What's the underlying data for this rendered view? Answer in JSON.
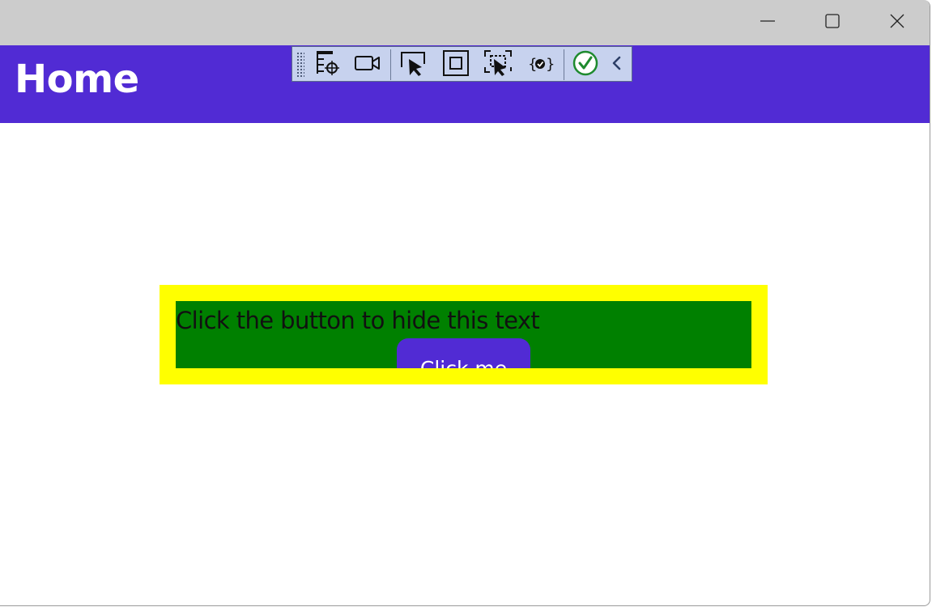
{
  "window": {
    "controls": {
      "minimize_icon": "minimize-icon",
      "maximize_icon": "maximize-icon",
      "close_icon": "close-icon"
    }
  },
  "header": {
    "title": "Home",
    "background_color": "#512bd4"
  },
  "debug_toolbar": {
    "tools": [
      {
        "icon": "go-to-live-visual-tree-icon"
      },
      {
        "icon": "record-icon"
      },
      {
        "icon": "select-element-icon"
      },
      {
        "icon": "display-layout-adorners-icon"
      },
      {
        "icon": "track-focus-icon"
      },
      {
        "icon": "binding-failures-icon"
      },
      {
        "icon": "hot-reload-status-check-icon"
      },
      {
        "icon": "collapse-chevron-icon"
      }
    ],
    "background_color": "#c7d2ee"
  },
  "content": {
    "outer_box_color": "#ffff00",
    "inner_box_color": "#008000",
    "message": "Click the button to hide this text",
    "button_label": "Click me",
    "button_color": "#512bd4"
  }
}
